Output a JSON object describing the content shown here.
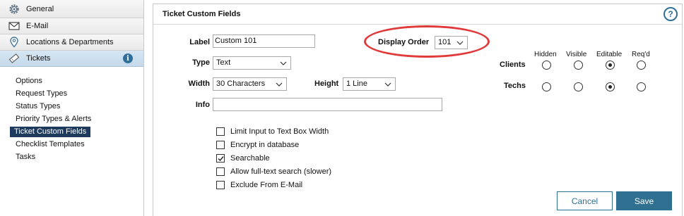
{
  "sidebar": {
    "nav": [
      {
        "label": "General",
        "icon": "gear-icon"
      },
      {
        "label": "E-Mail",
        "icon": "envelope-icon"
      },
      {
        "label": "Locations & Departments",
        "icon": "location-pin-icon"
      },
      {
        "label": "Tickets",
        "icon": "ticket-icon",
        "active": true
      }
    ],
    "tickets_info_glyph": "i",
    "sub_items": [
      {
        "label": "Options"
      },
      {
        "label": "Request Types"
      },
      {
        "label": "Status Types"
      },
      {
        "label": "Priority Types & Alerts"
      },
      {
        "label": "Ticket Custom Fields",
        "selected": true
      },
      {
        "label": "Checklist Templates"
      },
      {
        "label": "Tasks"
      }
    ]
  },
  "panel": {
    "title": "Ticket Custom Fields",
    "help_glyph": "?"
  },
  "form": {
    "label_label": "Label",
    "label_value": "Custom 101",
    "type_label": "Type",
    "type_value": "Text",
    "width_label": "Width",
    "width_value": "30 Characters",
    "height_label": "Height",
    "height_value": "1 Line",
    "info_label": "Info",
    "info_value": "",
    "display_order_label": "Display Order",
    "display_order_value": "101"
  },
  "visibility": {
    "columns": [
      "Hidden",
      "Visible",
      "Editable",
      "Req'd"
    ],
    "rows": [
      {
        "label": "Clients",
        "selected": "Editable"
      },
      {
        "label": "Techs",
        "selected": "Editable"
      }
    ]
  },
  "options": [
    {
      "label": "Limit Input to Text Box Width",
      "checked": false
    },
    {
      "label": "Encrypt in database",
      "checked": false
    },
    {
      "label": "Searchable",
      "checked": true
    },
    {
      "label": "Allow full-text search (slower)",
      "checked": false
    },
    {
      "label": "Exclude From E-Mail",
      "checked": false
    }
  ],
  "buttons": {
    "cancel": "Cancel",
    "save": "Save"
  },
  "colors": {
    "accent": "#2f6f8f",
    "highlight_ellipse": "#e03a3a",
    "selected_item_bg": "#1e3a5c"
  }
}
